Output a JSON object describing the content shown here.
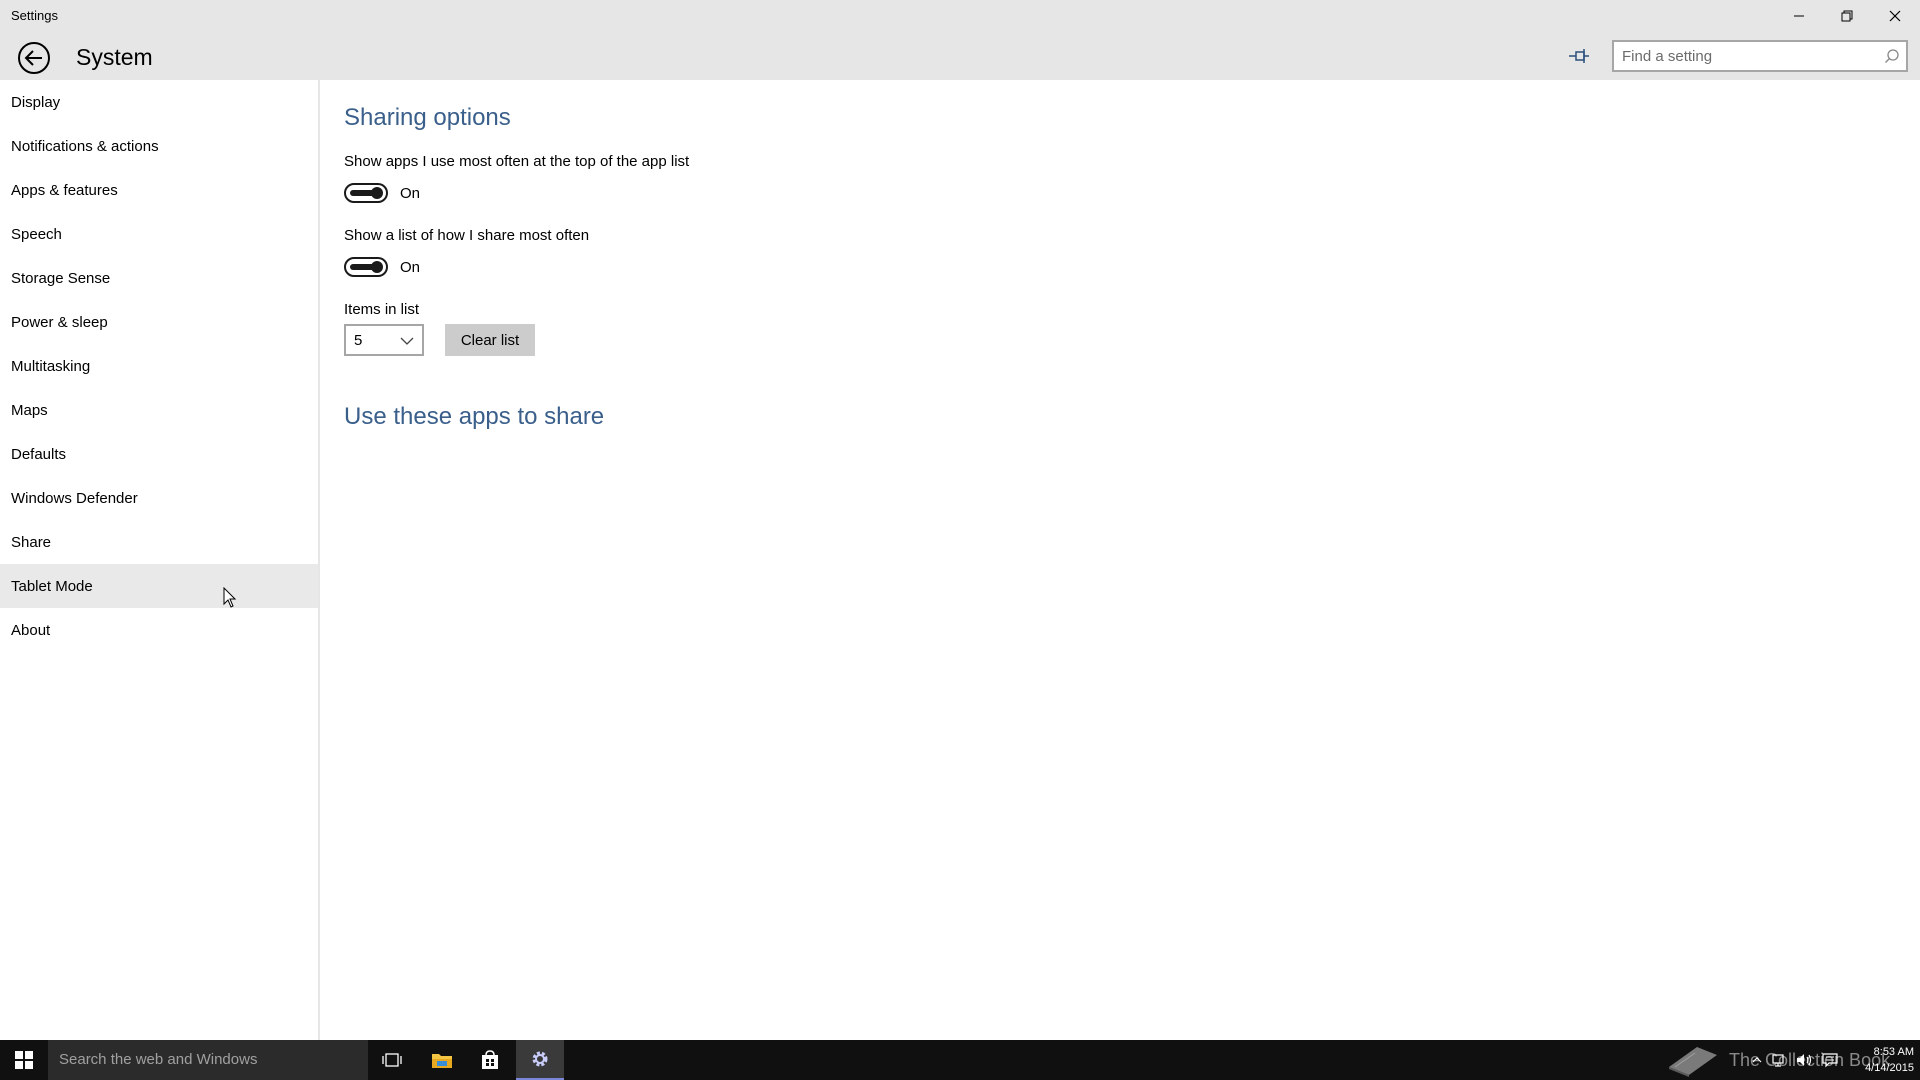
{
  "window": {
    "app_title": "Settings",
    "controls": [
      "minimize-icon",
      "restore-icon",
      "close-icon"
    ]
  },
  "header": {
    "page_title": "System",
    "search_placeholder": "Find a setting"
  },
  "sidebar": {
    "items": [
      {
        "label": "Display"
      },
      {
        "label": "Notifications & actions"
      },
      {
        "label": "Apps & features"
      },
      {
        "label": "Speech"
      },
      {
        "label": "Storage Sense"
      },
      {
        "label": "Power & sleep"
      },
      {
        "label": "Multitasking"
      },
      {
        "label": "Maps"
      },
      {
        "label": "Defaults"
      },
      {
        "label": "Windows Defender"
      },
      {
        "label": "Share"
      },
      {
        "label": "Tablet Mode"
      },
      {
        "label": "About"
      }
    ],
    "hovered_item": "Tablet Mode"
  },
  "main": {
    "sharing_title": "Sharing options",
    "option1": {
      "label": "Show apps I use most often at the top of the app list",
      "state": "On"
    },
    "option2": {
      "label": "Show a list of how I share most often",
      "state": "On"
    },
    "items_in_list": {
      "label": "Items in list",
      "value": "5"
    },
    "clear_button": "Clear list",
    "apps_title": "Use these apps to share"
  },
  "taskbar": {
    "search_placeholder": "Search the web and Windows",
    "watermark_text": "The Collection Book",
    "time": "8:53 AM",
    "date": "4/14/2015"
  },
  "colors": {
    "accent_title": "#3a5f8b",
    "chrome_bg": "#e6e6e6",
    "taskbar_bg": "#101010"
  }
}
